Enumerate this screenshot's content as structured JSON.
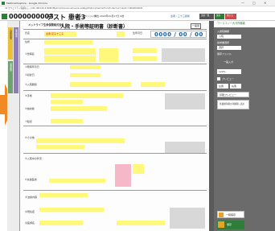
{
  "window": {
    "title": "MediCallCapture - Google Chrome",
    "url": "42 セキュリティ保護なし | 192.168.100.4:8080/Medical/Insurance/InsuranceRegistration/Claims/Form/Index?no=1&doc=0000000003",
    "controls": [
      "—",
      "□",
      "×"
    ]
  },
  "header": {
    "patient_id": "0000000003",
    "patient_name": "テスト 患者3",
    "patient_kana": "(テスト　カンジャ3)",
    "patient_detail": "男性 2020年10月17日 0歳",
    "right_label": "患者 : 三十三郎様",
    "tabs": [
      "患者一覧",
      "保存",
      "閉じる"
    ],
    "close_label": "閉じる"
  },
  "side_tabs": [
    {
      "label": "入通院情報",
      "color": "#e9bf3a"
    },
    {
      "label": "請求書類",
      "color": "#6fa06f"
    },
    {
      "label": "処置情報",
      "color": "#8f7bb6"
    }
  ],
  "document": {
    "company": "メットライフ生命保険株式会社",
    "title": "入院・手術等証明書（診断書）",
    "form_label": "一般用",
    "patient_name_value": "患者 花子十三子",
    "birth_label": "生年月日",
    "birth_value": "0000 / 00 / 00",
    "rows": [
      "氏名",
      "住所",
      "①傷病名",
      "②発病年月日",
      "③初診日",
      "④入院期間",
      "⑤手術",
      "⑥放射線",
      "⑦転帰",
      "⑧その他",
      "⑨入院中の状況",
      "⑩先進医療",
      "⑪治療内容",
      "⑫既往症",
      "⑬医師名"
    ]
  },
  "right_panel": {
    "logo": "ワースコンー大分所機能",
    "sections": [
      {
        "label": "入通院種類",
        "value": "入院"
      },
      {
        "label": "請求書選択",
        "value": "選択"
      },
      {
        "label": "保存ファイル",
        "value": ""
      }
    ],
    "mode_label": "一般入力",
    "zoom_value": "120%",
    "checkbox_label": "プレビュー",
    "toggle_left": "左寄",
    "toggle_right": "右寄",
    "buttons": [
      "印刷プレビュー",
      "各書類印刷の印刷時に表示"
    ],
    "bottom_buttons": [
      "一時保存",
      "保存"
    ]
  },
  "arrow": {
    "color": "#f08a24"
  }
}
